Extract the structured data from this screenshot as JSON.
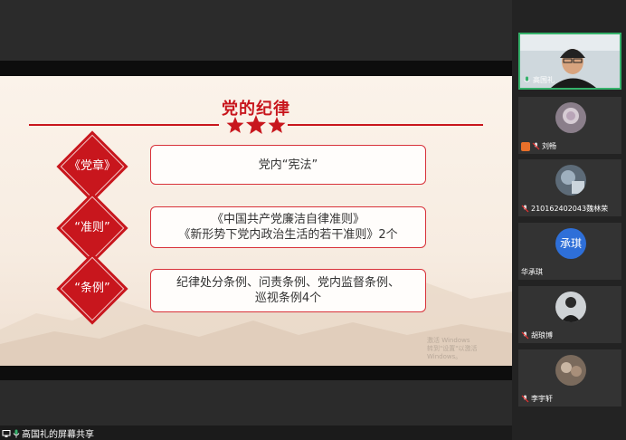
{
  "slide": {
    "title": "党的纪律",
    "items": [
      {
        "tag": "《党章》",
        "text_lines": [
          "党内“宪法”"
        ]
      },
      {
        "tag": "“准则”",
        "text_lines": [
          "《中国共产党廉洁自律准则》",
          "《新形势下党内政治生活的若干准则》2个"
        ]
      },
      {
        "tag": "“条例”",
        "text_lines": [
          "纪律处分条例、问责条例、党内监督条例、",
          "巡视条例4个"
        ]
      }
    ],
    "watermark_lines": [
      "激活 Windows",
      "转到\"设置\"以激活 Windows。"
    ]
  },
  "participants": [
    {
      "name": "高国礼",
      "avatar": "video-feed",
      "active": true
    },
    {
      "name": "刘畅",
      "avatar": "photo"
    },
    {
      "name": "210162402043魏林荣",
      "avatar": "photo"
    },
    {
      "name": "华承琪",
      "avatar": "initials",
      "initials": "承琪",
      "color": "#2e6fd8"
    },
    {
      "name": "胡琅博",
      "avatar": "photo"
    },
    {
      "name": "李宇轩",
      "avatar": "photo"
    }
  ],
  "screen_share_label": "高国礼的屏幕共享",
  "colors": {
    "accent": "#c8161d",
    "active_border": "#35b26b"
  }
}
